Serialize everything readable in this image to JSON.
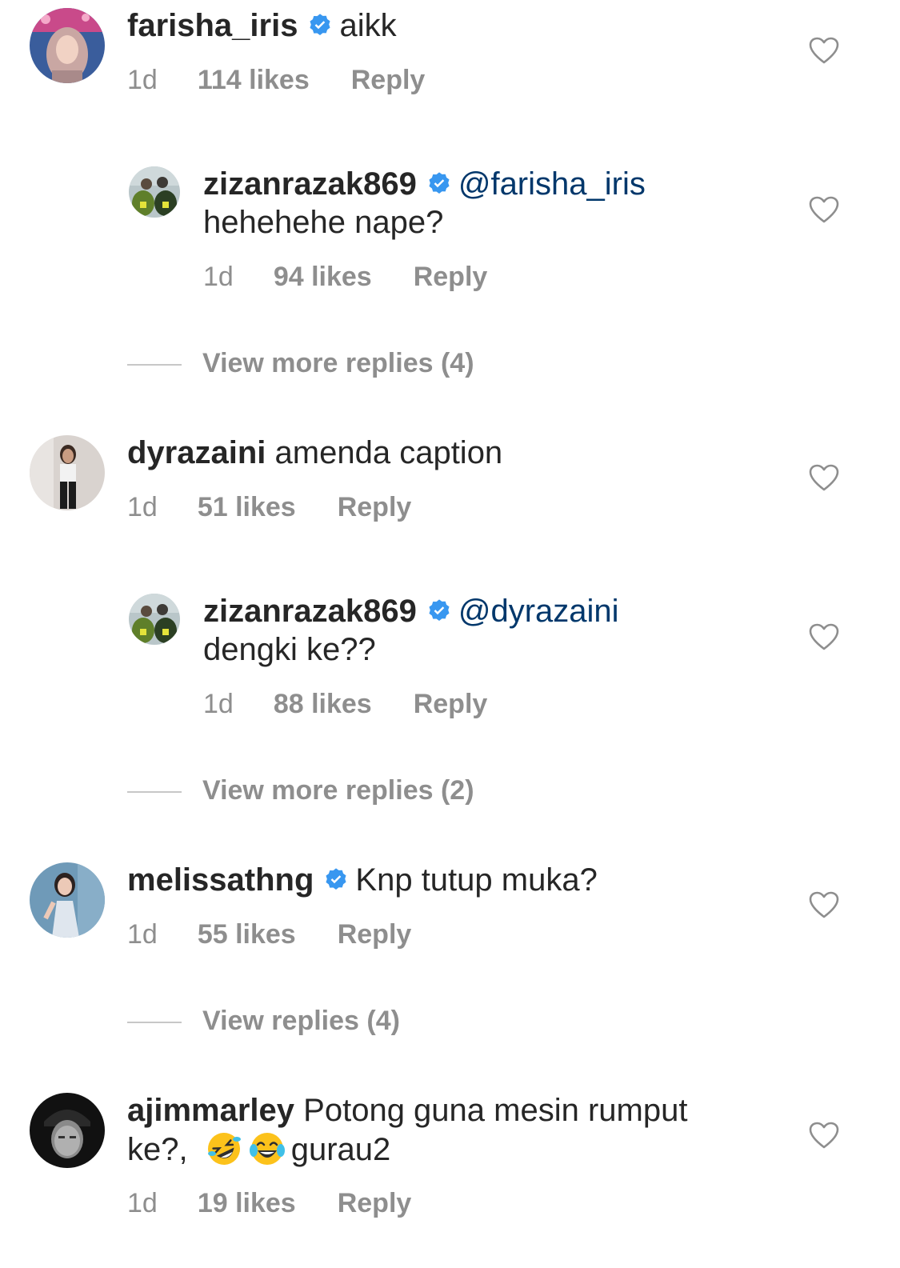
{
  "comments": [
    {
      "username": "farisha_iris",
      "verified": true,
      "text": "aikk",
      "time": "1d",
      "likes": "114 likes",
      "reply_label": "Reply",
      "reply": {
        "username": "zizanrazak869",
        "verified": true,
        "mention": "@farisha_iris",
        "text": "hehehehe nape?",
        "time": "1d",
        "likes": "94 likes",
        "reply_label": "Reply"
      },
      "view_more": "View more replies (4)"
    },
    {
      "username": "dyrazaini",
      "verified": false,
      "text": "amenda caption",
      "time": "1d",
      "likes": "51 likes",
      "reply_label": "Reply",
      "reply": {
        "username": "zizanrazak869",
        "verified": true,
        "mention": "@dyrazaini",
        "text": "dengki ke??",
        "time": "1d",
        "likes": "88 likes",
        "reply_label": "Reply"
      },
      "view_more": "View more replies (2)"
    },
    {
      "username": "melissathng",
      "verified": true,
      "text": "Knp tutup muka?",
      "time": "1d",
      "likes": "55 likes",
      "reply_label": "Reply",
      "view_more": "View replies (4)"
    },
    {
      "username": "ajimmarley",
      "verified": false,
      "text_line1": "Potong guna mesin rumput",
      "text_line2_start": "ke?,",
      "emojis": [
        "rolling-on-floor-laughing-emoji",
        "tears-of-joy-emoji"
      ],
      "text_line2_end": "gurau2",
      "time": "1d",
      "likes": "19 likes",
      "reply_label": "Reply"
    }
  ],
  "icons": {
    "like": "heart-outline-icon",
    "verified": "verified-badge-icon"
  },
  "colors": {
    "text": "#262626",
    "secondary": "#8e8e8e",
    "mention": "#00376b",
    "verified": "#3897f0",
    "divider": "#c7c7c7"
  }
}
